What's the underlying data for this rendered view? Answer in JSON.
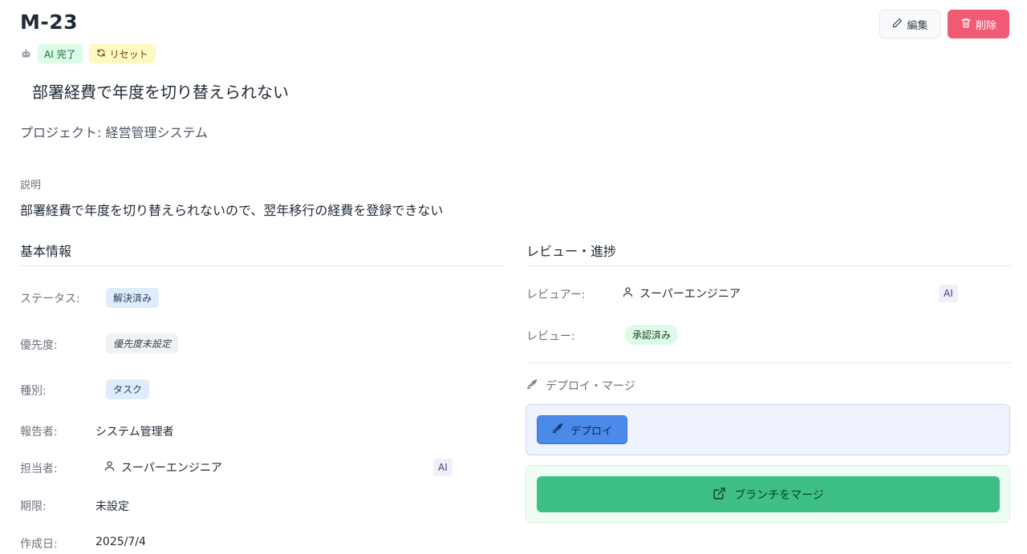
{
  "issue": {
    "key": "M-23",
    "title": "部署経費で年度を切り替えられない",
    "project_label": "プロジェクト: 経営管理システム",
    "ai_badge": "AI 完了",
    "reset_badge": "リセット"
  },
  "actions": {
    "edit_label": "編集",
    "delete_label": "削除"
  },
  "description": {
    "label": "説明",
    "text": "部署経費で年度を切り替えられないので、翌年移行の経費を登録できない"
  },
  "basic_info": {
    "title": "基本情報",
    "status": {
      "label": "ステータス:",
      "value": "解決済み"
    },
    "priority": {
      "label": "優先度:",
      "value": "優先度未設定"
    },
    "type": {
      "label": "種別:",
      "value": "タスク"
    },
    "reporter": {
      "label": "報告者:",
      "value": "システム管理者"
    },
    "assignee": {
      "label": "担当者:",
      "value": "スーパーエンジニア",
      "ai": "AI"
    },
    "due": {
      "label": "期限:",
      "value": "未設定"
    },
    "created": {
      "label": "作成日:",
      "value": "2025/7/4"
    }
  },
  "review": {
    "title": "レビュー・進捗",
    "reviewer": {
      "label": "レビュアー:",
      "value": "スーパーエンジニア",
      "ai": "AI"
    },
    "review_status": {
      "label": "レビュー:",
      "value": "承認済み"
    }
  },
  "deploy": {
    "heading": "デプロイ・マージ",
    "deploy_label": "デプロイ",
    "merge_label": "ブランチをマージ"
  },
  "colors": {
    "delete": "#f05a73",
    "deploy": "#4b8ae8",
    "merge": "#3dbf86"
  }
}
